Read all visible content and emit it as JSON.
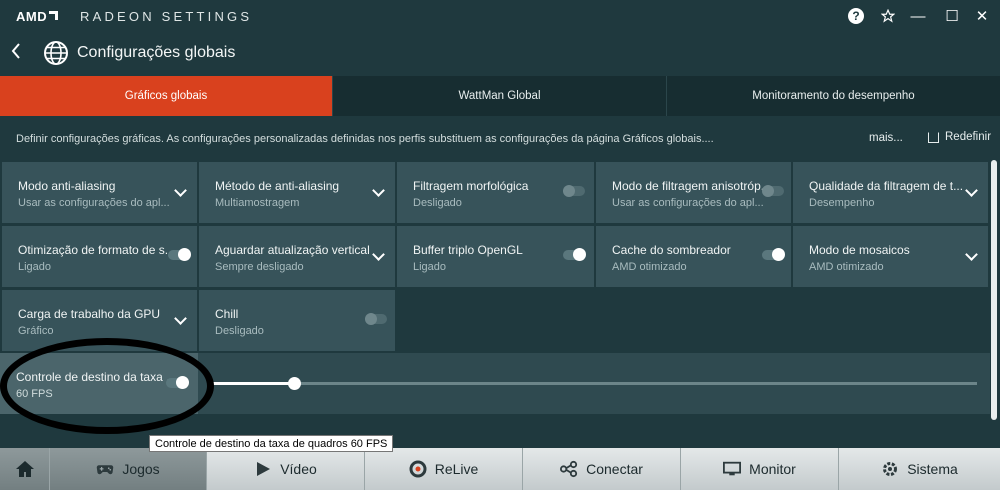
{
  "titlebar": {
    "logo": "AMD",
    "app_title": "RADEON SETTINGS",
    "help": "?",
    "minimize": "—",
    "maximize": "☐",
    "close": "✕"
  },
  "header": {
    "title": "Configurações globais"
  },
  "tabs": [
    {
      "label": "Gráficos globais",
      "active": true
    },
    {
      "label": "WattMan Global",
      "active": false
    },
    {
      "label": "Monitoramento do desempenho",
      "active": false
    }
  ],
  "description": {
    "text": "Definir configurações gráficas. As configurações personalizadas definidas nos perfis substituem as configurações da página Gráficos globais....",
    "more": "mais...",
    "reset": "Redefinir"
  },
  "settings": [
    {
      "label": "Modo anti-aliasing",
      "value": "Usar as configurações do apl...",
      "control": "dropdown"
    },
    {
      "label": "Método de anti-aliasing",
      "value": "Multiamostragem",
      "control": "dropdown"
    },
    {
      "label": "Filtragem morfológica",
      "value": "Desligado",
      "control": "toggle-off"
    },
    {
      "label": "Modo de filtragem anisotróp...",
      "value": "Usar as configurações do apl...",
      "control": "toggle-off"
    },
    {
      "label": "Qualidade da filtragem de t...",
      "value": "Desempenho",
      "control": "dropdown"
    },
    {
      "label": "Otimização de formato de s...",
      "value": "Ligado",
      "control": "toggle-on"
    },
    {
      "label": "Aguardar atualização vertical",
      "value": "Sempre desligado",
      "control": "dropdown"
    },
    {
      "label": "Buffer triplo OpenGL",
      "value": "Ligado",
      "control": "toggle-on"
    },
    {
      "label": "Cache do sombreador",
      "value": "AMD otimizado",
      "control": "toggle-on"
    },
    {
      "label": "Modo de mosaicos",
      "value": "AMD otimizado",
      "control": "dropdown"
    },
    {
      "label": "Carga de trabalho da GPU",
      "value": "Gráfico",
      "control": "dropdown"
    },
    {
      "label": "Chill",
      "value": "Desligado",
      "control": "toggle-off"
    }
  ],
  "frame_target": {
    "label": "Controle de destino da taxa ...",
    "value": "60 FPS",
    "enabled": true,
    "slider_level": 0.11
  },
  "tooltip": "Controle de destino da taxa de quadros 60 FPS",
  "bottom_nav": [
    {
      "label": "",
      "icon": "home-icon",
      "active": true
    },
    {
      "label": "Jogos",
      "icon": "gamepad-icon",
      "active": true
    },
    {
      "label": "Vídeo",
      "icon": "play-icon",
      "active": false
    },
    {
      "label": "ReLive",
      "icon": "relive-icon",
      "active": false
    },
    {
      "label": "Conectar",
      "icon": "connect-icon",
      "active": false
    },
    {
      "label": "Monitor",
      "icon": "monitor-icon",
      "active": false
    },
    {
      "label": "Sistema",
      "icon": "system-gear-icon",
      "active": false
    }
  ],
  "colors": {
    "background": "#1f393e",
    "accent": "#d9411e",
    "card": "#37535a",
    "annotation": "#000000"
  }
}
